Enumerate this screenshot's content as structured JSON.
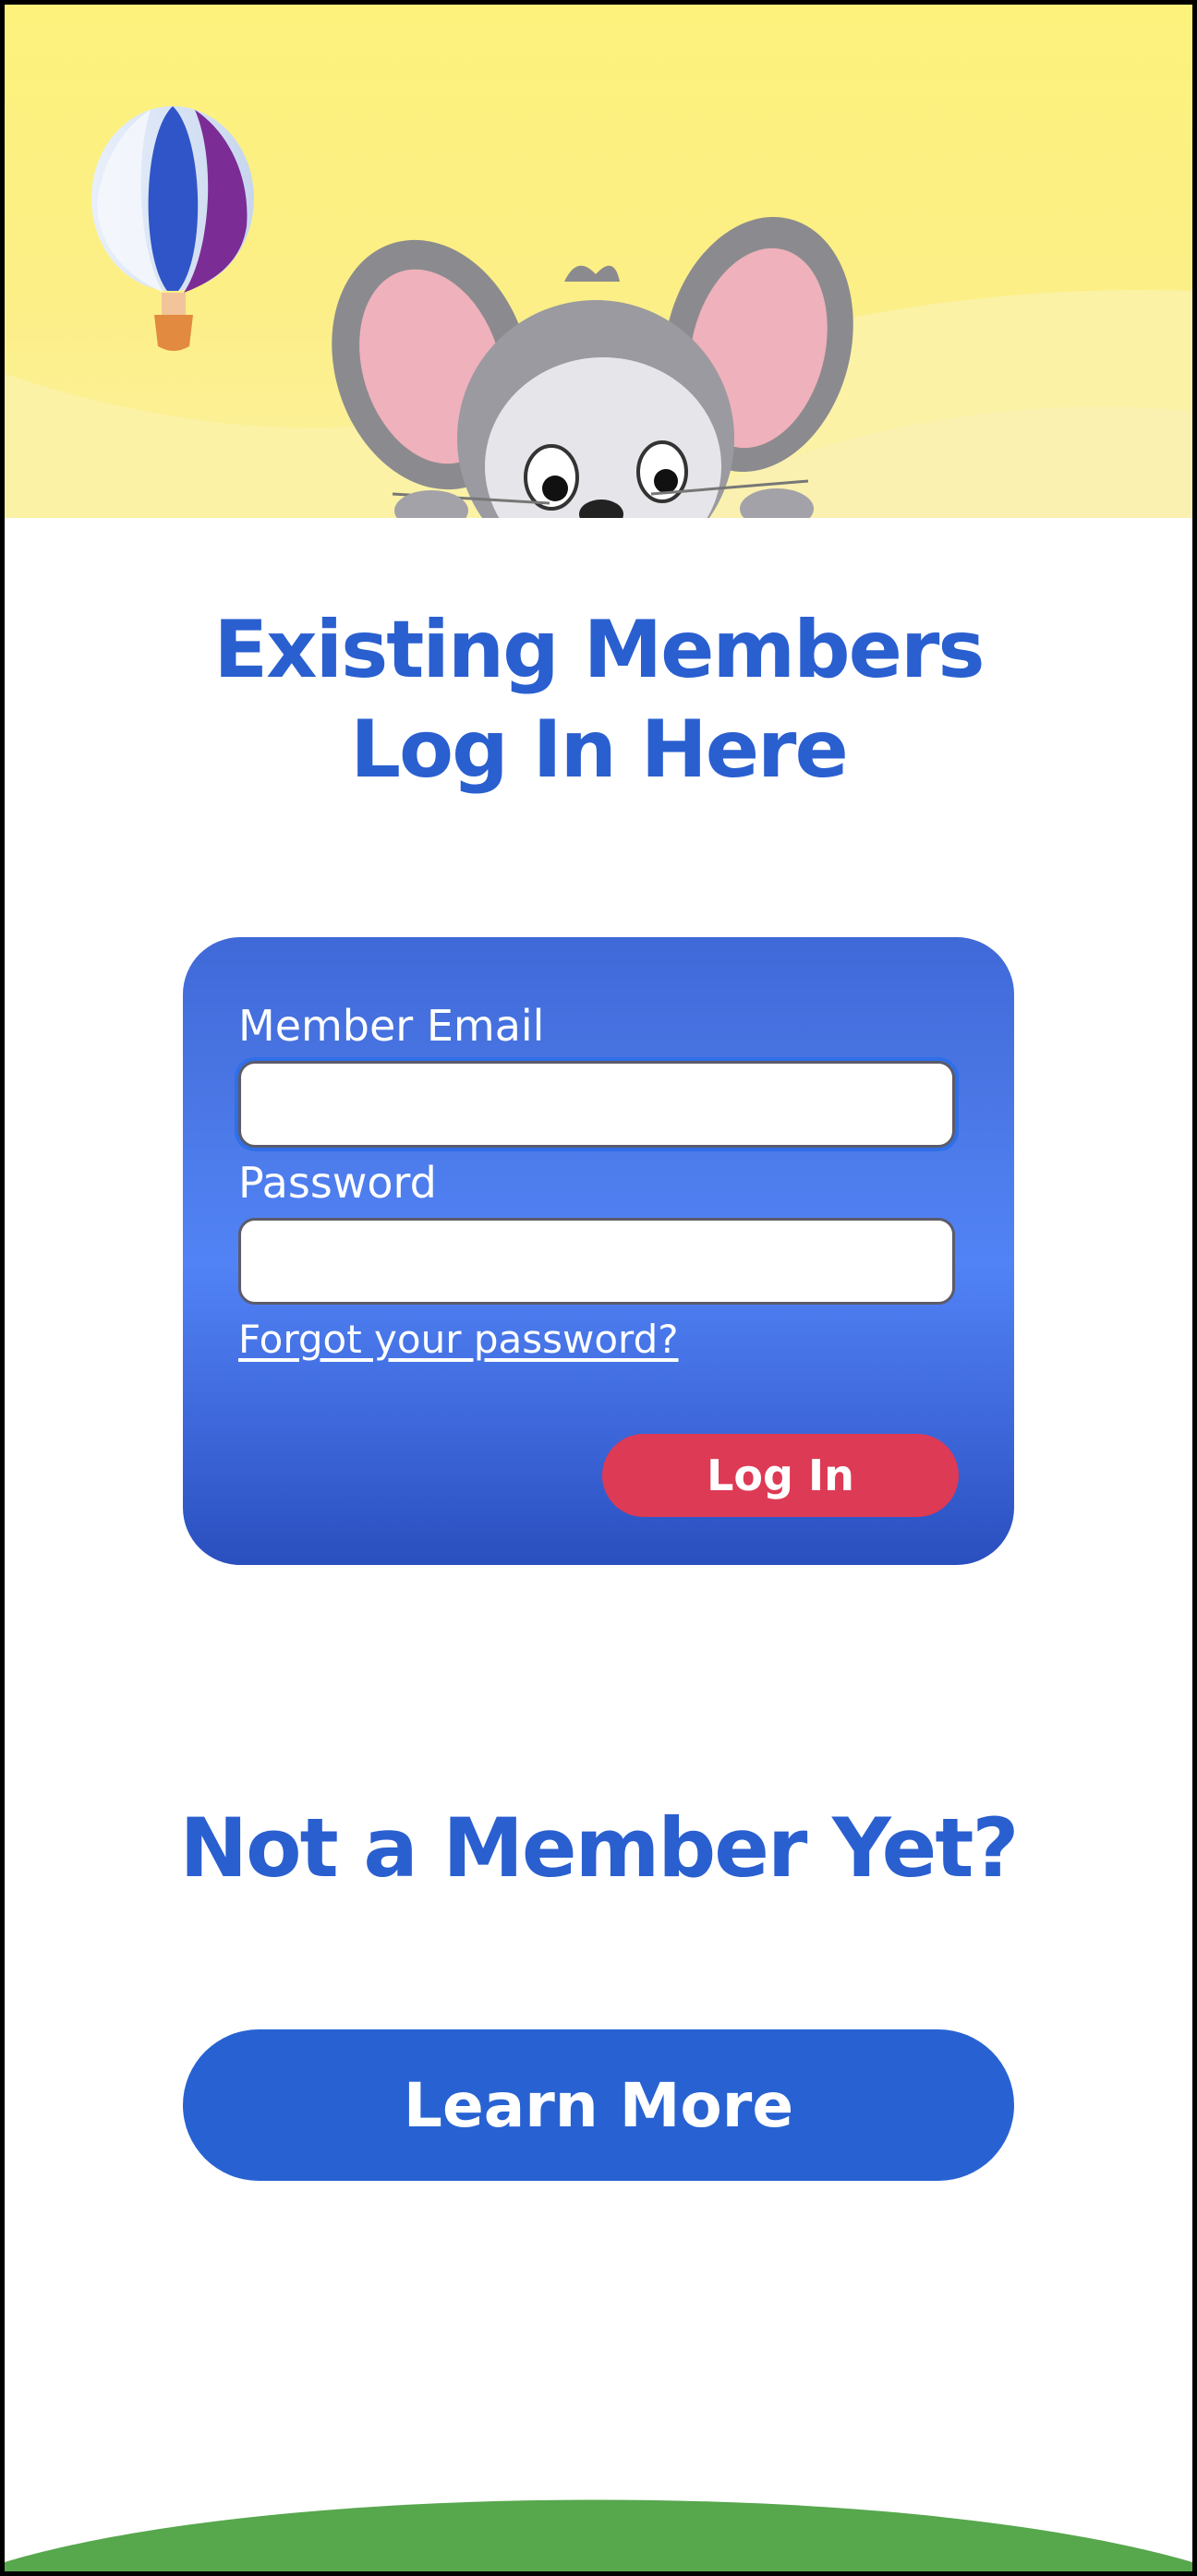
{
  "header": {
    "balloon_icon": "hot-air-balloon-icon",
    "mascot_icon": "mouse-mascot-icon"
  },
  "existing_members": {
    "title_line1": "Existing Members",
    "title_line2": "Log In Here"
  },
  "login_form": {
    "email_label": "Member Email",
    "email_value": "",
    "password_label": "Password",
    "password_value": "",
    "forgot_password": "Forgot your password?",
    "login_button": "Log In"
  },
  "signup": {
    "title": "Not a Member Yet?",
    "learn_more_button": "Learn More"
  },
  "colors": {
    "heading_blue": "#2a5fd0",
    "card_blue": "#4b78e6",
    "login_red": "#dd3a55",
    "learn_more_blue": "#2862d2",
    "header_yellow": "#fdf27c",
    "hill_green": "#57a74d"
  }
}
